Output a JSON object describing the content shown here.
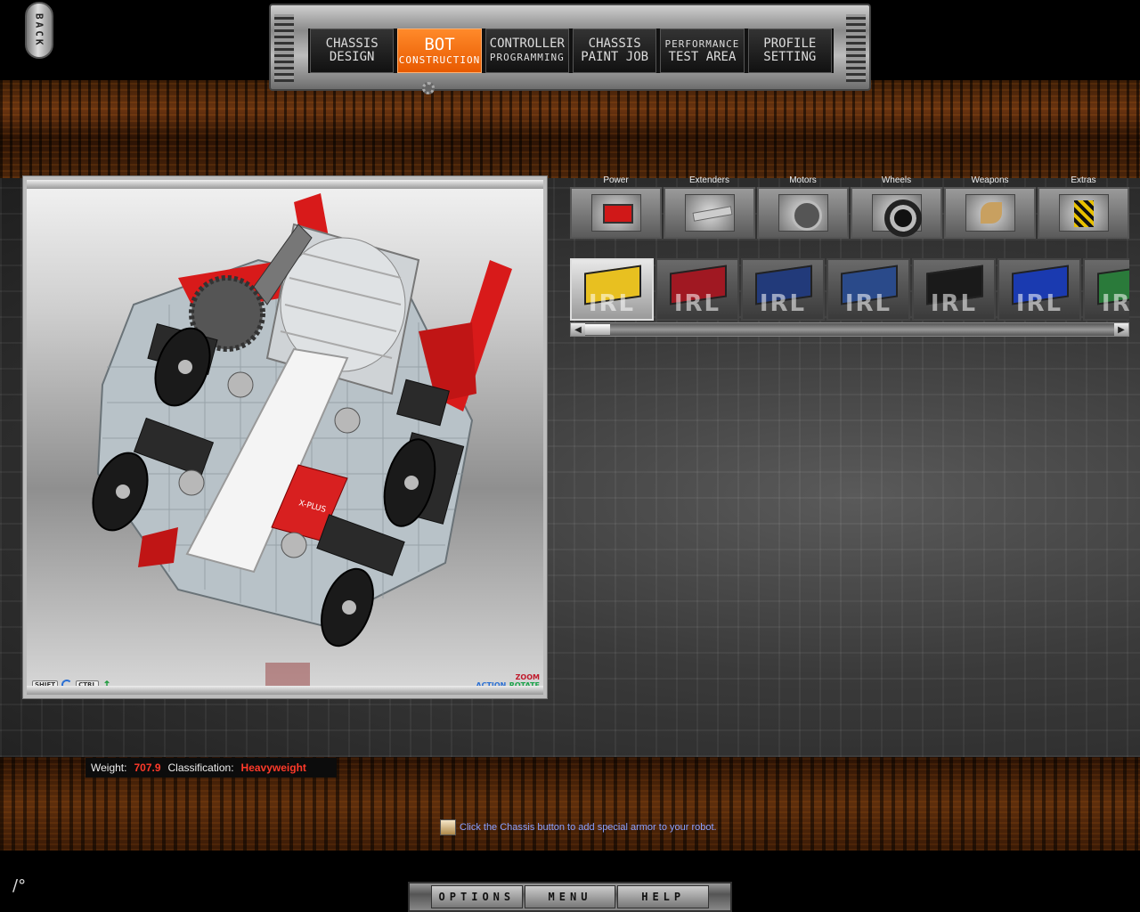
{
  "back_button": {
    "label": "BACK"
  },
  "nav": {
    "tabs": [
      {
        "line1": "CHASSIS",
        "line2": "DESIGN",
        "active": false
      },
      {
        "line1": "BOT",
        "line2": "CONSTRUCTION",
        "active": true
      },
      {
        "line1": "CONTROLLER",
        "line2": "PROGRAMMING",
        "active": false
      },
      {
        "line1": "CHASSIS",
        "line2": "PAINT JOB",
        "active": false
      },
      {
        "line1": "PERFORMANCE",
        "line2": "TEST AREA",
        "active": false
      },
      {
        "line1": "PROFILE",
        "line2": "SETTING",
        "active": false
      }
    ]
  },
  "viewport": {
    "controls": {
      "shift": "SHIFT",
      "ctrl": "CTRL"
    },
    "help": {
      "zoom": "ZOOM",
      "action": "ACTION",
      "rotate": "ROTATE"
    }
  },
  "categories": [
    {
      "label": "Power",
      "icon": "battery-icon"
    },
    {
      "label": "Extenders",
      "icon": "extender-bar-icon"
    },
    {
      "label": "Motors",
      "icon": "motor-icon"
    },
    {
      "label": "Wheels",
      "icon": "wheel-icon"
    },
    {
      "label": "Weapons",
      "icon": "weapon-icon"
    },
    {
      "label": "Extras",
      "icon": "extras-icon"
    }
  ],
  "parts": [
    {
      "brand": "IRL",
      "color": "#e8c020",
      "selected": true
    },
    {
      "brand": "IRL",
      "color": "#a01822",
      "selected": false
    },
    {
      "brand": "IRL",
      "color": "#223a7a",
      "selected": false
    },
    {
      "brand": "IRL",
      "color": "#2a4a8a",
      "selected": false
    },
    {
      "brand": "IRL",
      "color": "#1a1a1a",
      "selected": false
    },
    {
      "brand": "IRL",
      "color": "#1a3ab0",
      "selected": false
    },
    {
      "brand": "IRL",
      "color": "#2a7a3a",
      "selected": false
    }
  ],
  "stats": {
    "weight_label": "Weight:",
    "weight_value": "707.9",
    "class_label": "Classification:",
    "class_value": "Heavyweight"
  },
  "tip": {
    "text": "Click the Chassis button to add special armor to your robot."
  },
  "bottom_menu": {
    "options": "OPTIONS",
    "menu": "MENU",
    "help": "HELP"
  },
  "colors": {
    "accent": "#ff7a10",
    "robot_red": "#d81a1a",
    "stat_value": "#ff3a2a",
    "tip_text": "#8aa0ff"
  }
}
